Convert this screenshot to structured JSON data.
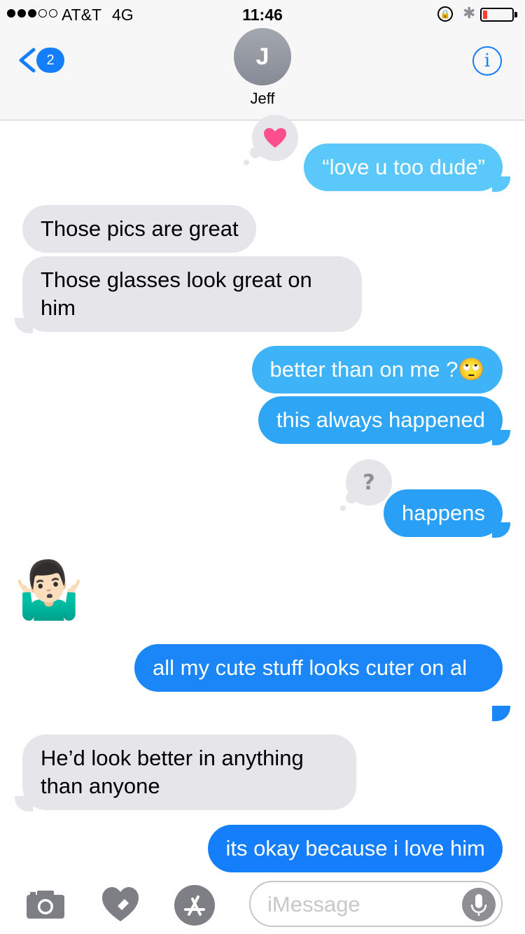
{
  "status_bar": {
    "carrier": "AT&T",
    "network": "4G",
    "time": "11:46",
    "signal_bars": 3,
    "signal_max": 5,
    "battery_level": 0.15
  },
  "header": {
    "back_count": "2",
    "avatar_initial": "J",
    "contact_name": "Jeff",
    "info_icon": "info-icon"
  },
  "messages": [
    {
      "from": "me",
      "text": "“love u too dude”",
      "tapback": "heart"
    },
    {
      "from": "them",
      "text": "Those pics are great"
    },
    {
      "from": "them",
      "text": "Those glasses look great on him"
    },
    {
      "from": "me",
      "text": "better than on me ?🙄"
    },
    {
      "from": "me",
      "text": "this always happened"
    },
    {
      "from": "me",
      "text": "happens",
      "tapback": "question"
    },
    {
      "from": "them",
      "text": "🤷🏻‍♂️"
    },
    {
      "from": "me",
      "text": "all my cute stuff looks cuter on al"
    },
    {
      "from": "them",
      "text": "He’d look better in anything than anyone"
    },
    {
      "from": "me",
      "text": "its okay because i love him"
    }
  ],
  "composer": {
    "placeholder": "iMessage"
  },
  "colors": {
    "imessage_blue": "#147efb",
    "light_blue": "#5ac8fa",
    "incoming_gray": "#e5e5ea"
  }
}
